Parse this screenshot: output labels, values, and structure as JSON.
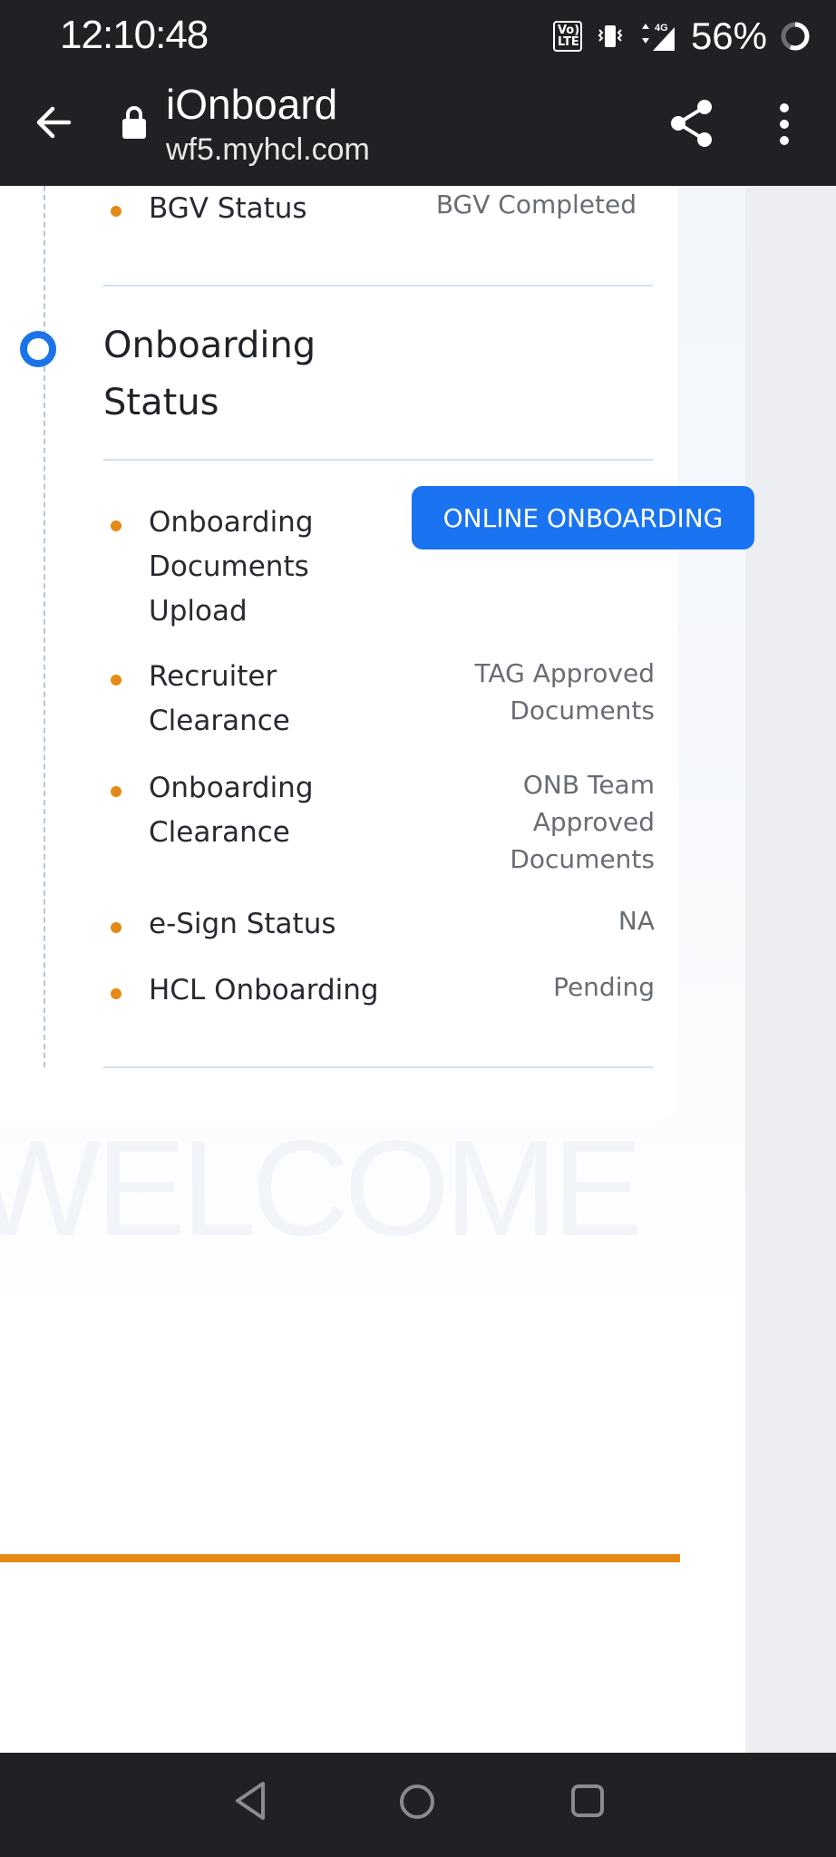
{
  "status_bar": {
    "time": "12:10:48",
    "volte_top": "Vo)",
    "volte_bottom": "LTE",
    "network": "4G",
    "battery": "56%",
    "icons": [
      "volte-icon",
      "vibrate-icon",
      "signal-icon",
      "battery-ring-icon"
    ]
  },
  "browser": {
    "title": "iOnboard",
    "url": "wf5.myhcl.com",
    "icons": [
      "back-arrow-icon",
      "lock-icon",
      "share-icon",
      "more-vert-icon"
    ]
  },
  "bgv": {
    "label": "BGV Status",
    "value": "BGV Completed"
  },
  "onboarding": {
    "title_line1": "Onboarding",
    "title_line2": "Status",
    "items": [
      {
        "label_lines": [
          "Onboarding",
          "Documents",
          "Upload"
        ],
        "action": "ONLINE ONBOARDING"
      },
      {
        "label_lines": [
          "Recruiter",
          "Clearance"
        ],
        "value_lines": [
          "TAG Approved",
          "Documents"
        ]
      },
      {
        "label_lines": [
          "Onboarding",
          "Clearance"
        ],
        "value_lines": [
          "ONB Team",
          "Approved",
          "Documents"
        ]
      },
      {
        "label_lines": [
          "e-Sign Status"
        ],
        "value_lines": [
          "NA"
        ]
      },
      {
        "label_lines": [
          "HCL Onboarding"
        ],
        "value_lines": [
          "Pending"
        ]
      }
    ]
  },
  "background_text": "WELCOME",
  "colors": {
    "accent_blue": "#1a73f0",
    "bullet_orange": "#e58a14",
    "chrome_dark": "#202124"
  },
  "navbar": {
    "icons": [
      "nav-back-icon",
      "nav-home-icon",
      "nav-recents-icon"
    ]
  }
}
